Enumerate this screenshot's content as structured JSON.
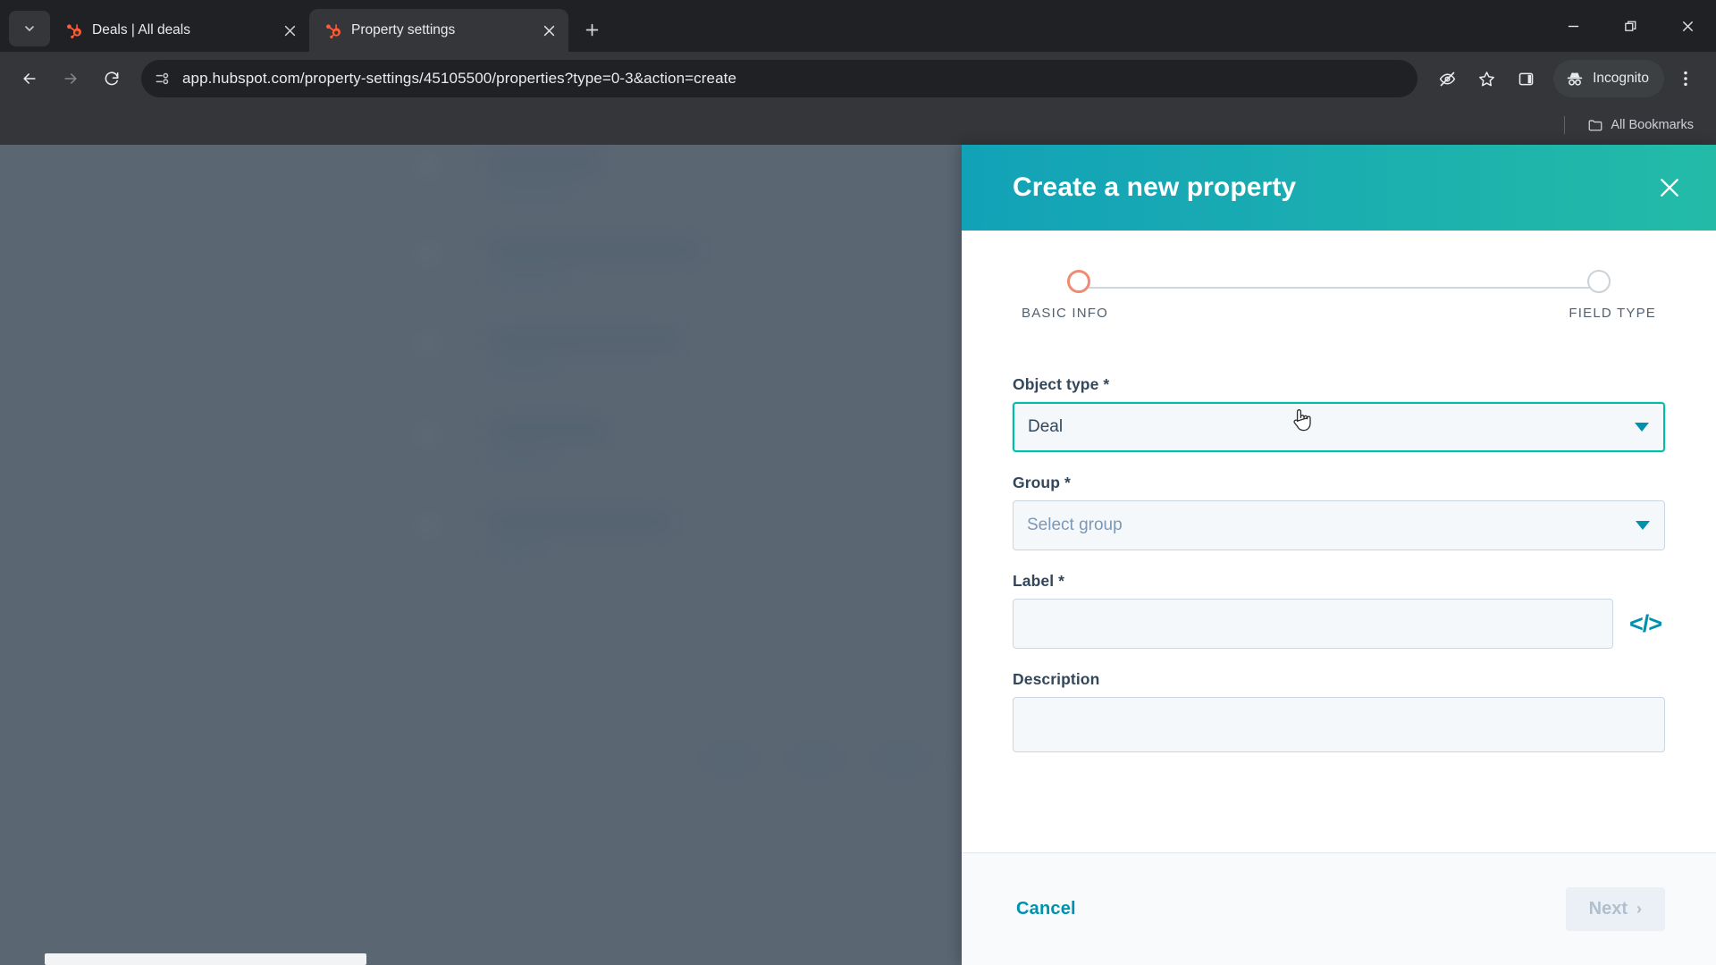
{
  "browser": {
    "tab_search_icon": "chevron-down-icon",
    "tabs": [
      {
        "title": "Deals | All deals",
        "favicon": "hubspot-favicon",
        "active": false
      },
      {
        "title": "Property settings",
        "favicon": "hubspot-favicon",
        "active": true
      }
    ],
    "new_tab_label": "+",
    "window_controls": [
      "minimize-icon",
      "restore-icon",
      "close-icon"
    ],
    "nav": {
      "back_icon": "arrow-left-icon",
      "forward_icon": "arrow-right-icon",
      "reload_icon": "reload-icon"
    },
    "omnibox": {
      "site_icon": "page-info-icon",
      "url": "app.hubspot.com/property-settings/45105500/properties?type=0-3&action=create"
    },
    "actions": {
      "tracking_protection_icon": "eye-off-icon",
      "bookmark_icon": "star-icon",
      "side_panel_icon": "side-panel-icon",
      "incognito_label": "Incognito",
      "incognito_icon": "incognito-hat-icon",
      "menu_icon": "three-dot-menu-icon"
    },
    "bookmarks_bar": {
      "folder_icon": "folder-icon",
      "all_bookmarks_label": "All Bookmarks"
    }
  },
  "panel": {
    "title": "Create a new property",
    "close_icon": "close-icon",
    "stepper": {
      "steps": [
        {
          "label": "BASIC INFO",
          "active": true
        },
        {
          "label": "FIELD TYPE",
          "active": false
        }
      ],
      "active_color": "#ef8b72",
      "inactive_color": "#cbd2d8"
    },
    "form": {
      "object_type": {
        "label": "Object type *",
        "value": "Deal",
        "caret_icon": "chevron-down-icon",
        "focused": true
      },
      "group": {
        "label": "Group *",
        "placeholder": "Select group",
        "value": "",
        "caret_icon": "chevron-down-icon"
      },
      "label_field": {
        "label": "Label *",
        "value": "",
        "placeholder": "",
        "code_icon": "code-brackets-icon"
      },
      "description": {
        "label": "Description",
        "value": "",
        "placeholder": ""
      }
    },
    "footer": {
      "cancel_label": "Cancel",
      "next_label": "Next",
      "next_chevron": "chevron-right-icon",
      "next_disabled": true
    },
    "colors": {
      "header_gradient_start": "#12a2b8",
      "header_gradient_end": "#23bba7",
      "accent": "#0091ae",
      "focus_border": "#00bda5"
    }
  },
  "background": {
    "overlay_color": "#5a6672",
    "scrollbar": "horizontal-scrollbar"
  }
}
